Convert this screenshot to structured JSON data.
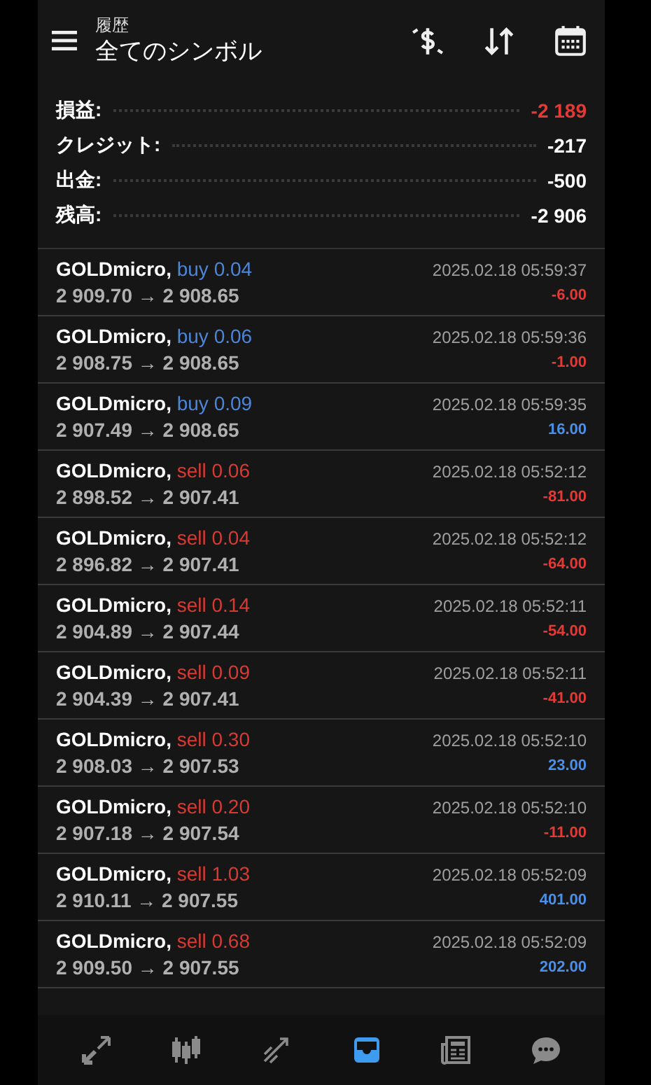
{
  "header": {
    "subtitle": "履歴",
    "title": "全てのシンボル"
  },
  "summary": [
    {
      "label": "損益:",
      "value": "-2 189",
      "color": "#e53935"
    },
    {
      "label": "クレジット:",
      "value": "-217",
      "color": "#ffffff"
    },
    {
      "label": "出金:",
      "value": "-500",
      "color": "#ffffff"
    },
    {
      "label": "残高:",
      "value": "-2 906",
      "color": "#ffffff"
    }
  ],
  "deals": [
    {
      "symbol": "GOLDmicro,",
      "kind": "buy",
      "side": "buy 0.04",
      "prices": "2 909.70 → 2 908.65",
      "time": "2025.02.18 05:59:37",
      "profit": "-6.00",
      "loss": true
    },
    {
      "symbol": "GOLDmicro,",
      "kind": "buy",
      "side": "buy 0.06",
      "prices": "2 908.75 → 2 908.65",
      "time": "2025.02.18 05:59:36",
      "profit": "-1.00",
      "loss": true
    },
    {
      "symbol": "GOLDmicro,",
      "kind": "buy",
      "side": "buy 0.09",
      "prices": "2 907.49 → 2 908.65",
      "time": "2025.02.18 05:59:35",
      "profit": "16.00",
      "loss": false
    },
    {
      "symbol": "GOLDmicro,",
      "kind": "sell",
      "side": "sell 0.06",
      "prices": "2 898.52 → 2 907.41",
      "time": "2025.02.18 05:52:12",
      "profit": "-81.00",
      "loss": true
    },
    {
      "symbol": "GOLDmicro,",
      "kind": "sell",
      "side": "sell 0.04",
      "prices": "2 896.82 → 2 907.41",
      "time": "2025.02.18 05:52:12",
      "profit": "-64.00",
      "loss": true
    },
    {
      "symbol": "GOLDmicro,",
      "kind": "sell",
      "side": "sell 0.14",
      "prices": "2 904.89 → 2 907.44",
      "time": "2025.02.18 05:52:11",
      "profit": "-54.00",
      "loss": true
    },
    {
      "symbol": "GOLDmicro,",
      "kind": "sell",
      "side": "sell 0.09",
      "prices": "2 904.39 → 2 907.41",
      "time": "2025.02.18 05:52:11",
      "profit": "-41.00",
      "loss": true
    },
    {
      "symbol": "GOLDmicro,",
      "kind": "sell",
      "side": "sell 0.30",
      "prices": "2 908.03 → 2 907.53",
      "time": "2025.02.18 05:52:10",
      "profit": "23.00",
      "loss": false
    },
    {
      "symbol": "GOLDmicro,",
      "kind": "sell",
      "side": "sell 0.20",
      "prices": "2 907.18 → 2 907.54",
      "time": "2025.02.18 05:52:10",
      "profit": "-11.00",
      "loss": true
    },
    {
      "symbol": "GOLDmicro,",
      "kind": "sell",
      "side": "sell 1.03",
      "prices": "2 910.11 → 2 907.55",
      "time": "2025.02.18 05:52:09",
      "profit": "401.00",
      "loss": false
    },
    {
      "symbol": "GOLDmicro,",
      "kind": "sell",
      "side": "sell 0.68",
      "prices": "2 909.50 → 2 907.55",
      "time": "2025.02.18 05:52:09",
      "profit": "202.00",
      "loss": false
    }
  ],
  "nav": [
    {
      "kind": "trade",
      "selected": false
    },
    {
      "kind": "quotes",
      "selected": false
    },
    {
      "kind": "chart",
      "selected": false
    },
    {
      "kind": "history",
      "selected": true
    },
    {
      "kind": "news",
      "selected": false
    },
    {
      "kind": "chat",
      "selected": false
    }
  ]
}
